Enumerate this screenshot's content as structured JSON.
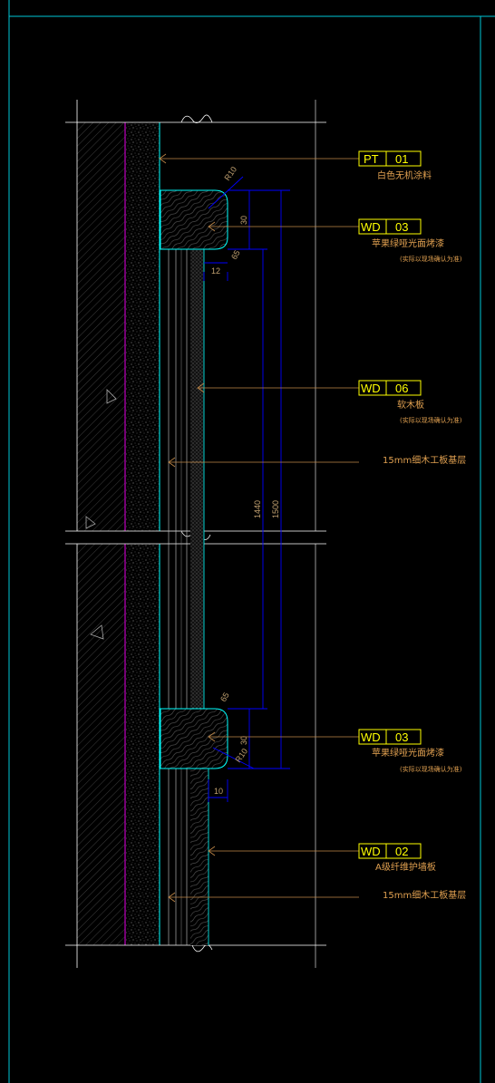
{
  "colors": {
    "background": "#000000",
    "frame": "#00c8d8",
    "wall_line": "#ffffff",
    "hatch": "#9a9a9a",
    "magenta_line": "#c000c0",
    "dimension": "#0000ff",
    "leader": "#c08848",
    "tag_box": "#ffff00",
    "tag_text": "#ffff00",
    "note_text": "#e0a050",
    "board_cyan": "#00ffff"
  },
  "tags": [
    {
      "code": "PT",
      "number": "01",
      "note": "白色无机涂料",
      "sub_note": ""
    },
    {
      "code": "WD",
      "number": "03",
      "note": "苹果绿哑光面烤漆",
      "sub_note": "(实际以现场确认为准)"
    },
    {
      "code": "WD",
      "number": "06",
      "note": "软木板",
      "sub_note": "(实际以现场确认为准)"
    },
    {
      "code": "WD",
      "number": "03",
      "note": "苹果绿哑光面烤漆",
      "sub_note": "(实际以现场确认为准)"
    },
    {
      "code": "WD",
      "number": "02",
      "note": "A级纤维护墙板",
      "sub_note": ""
    }
  ],
  "plain_notes": [
    {
      "text": "15mm细木工板基层"
    },
    {
      "text": "15mm细木工板基层"
    }
  ],
  "dimensions": {
    "top_r": "R10",
    "top_h": "30",
    "top_small": "65",
    "top_gap": "12",
    "mid_1440": "1440",
    "mid_1500": "1500",
    "bot_small": "65",
    "bot_h": "30",
    "bot_r": "R10",
    "bot_gap": "10"
  }
}
